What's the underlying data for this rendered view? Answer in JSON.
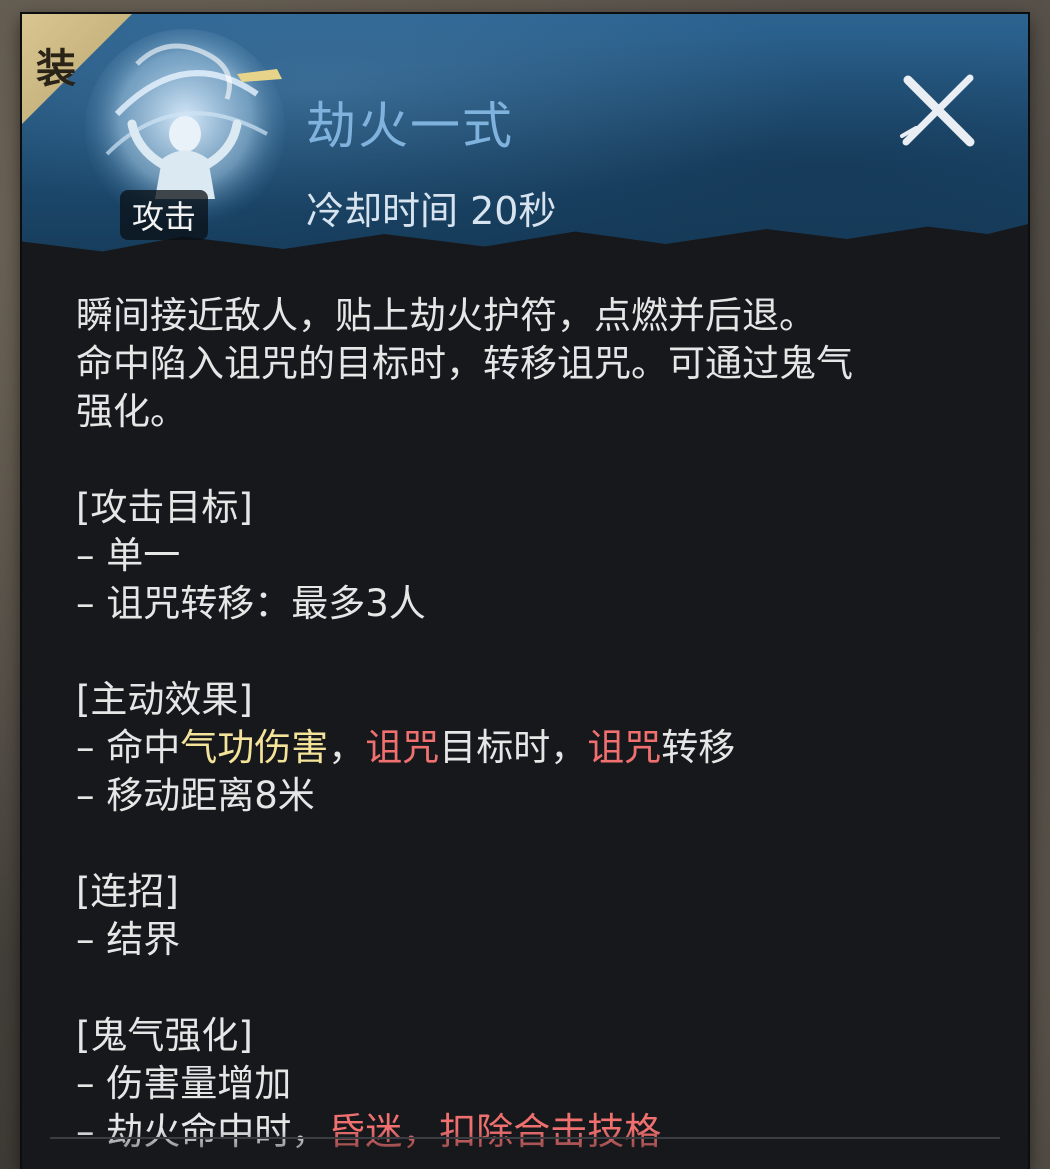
{
  "header": {
    "equip_badge": "装",
    "skill_type": "攻击",
    "skill_name": "劫火一式",
    "cooldown": "冷却时间 20秒",
    "close_icon": "close-icon"
  },
  "colors": {
    "header_blue": "#1e4d73",
    "title_blue": "#7fb3de",
    "highlight_yellow": "#f4e39a",
    "highlight_red": "#f07070",
    "panel_bg": "#16181b"
  },
  "description": [
    "瞬间接近敌人，贴上劫火护符，点燃并后退。",
    "命中陷入诅咒的目标时，转移诅咒。可通过鬼气",
    "强化。"
  ],
  "sections": {
    "attack_target": {
      "title": "[攻击目标]",
      "item1": "– 单一",
      "item2": "– 诅咒转移：最多3人"
    },
    "active_effect": {
      "title": "[主动效果]",
      "item1_prefix": "– 命中",
      "item1_hl1": "气功伤害",
      "item1_sep": "，",
      "item1_hl2": "诅咒",
      "item1_mid": "目标时，",
      "item1_hl3": "诅咒",
      "item1_suffix": "转移",
      "item2": "– 移动距离8米"
    },
    "combo": {
      "title": "[连招]",
      "item1": "– 结界"
    },
    "ghost_enhance": {
      "title": "[鬼气强化]",
      "item1": "– 伤害量增加",
      "item2_prefix": "– 劫火命中时，",
      "item2_hl1": "昏迷",
      "item2_sep": "，",
      "item2_hl2": "扣除合击技格"
    }
  }
}
